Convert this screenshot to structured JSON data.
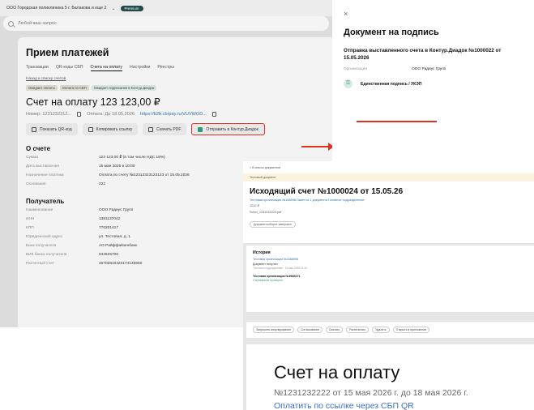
{
  "app": {
    "org": "ООО Городская поликлиника 5 г. Балакова и еще 2",
    "premium": "Premium",
    "search_placeholder": "Любой ваш запрос"
  },
  "page": {
    "title": "Прием платежей",
    "tabs": [
      "Транзакции",
      "QR-коды СБП",
      "Счета на оплату",
      "Настройки",
      "Реестры"
    ],
    "back": "Назад к списку счетов",
    "badges": [
      "Ожидает оплаты",
      "Оплата по СБП",
      "Ожидает подписания в Контур.Диадок"
    ],
    "invoice_title": "Счет на оплату 123 123,00 ₽",
    "number": "Номер: 1231232312...",
    "due": "Оплата: До 18.05.2026",
    "link": "https://b2b.cbrpay.ru/VUVWGD...",
    "actions": [
      "Показать QR-код",
      "Копировать ссылку",
      "Скачать PDF",
      "Отправить в Контур.Диадок"
    ]
  },
  "about": {
    "title": "О счете",
    "rows": [
      {
        "k": "Сумма",
        "v": "123 123,00 ₽ (в том числе НДС 18%)"
      },
      {
        "k": "Дата выставления",
        "v": "15 мая 2026 в 10:00"
      },
      {
        "k": "Назначение платежа",
        "v": "Оплата по счету №12312323123123 от 15.05.2026"
      },
      {
        "k": "Основание",
        "v": "222"
      }
    ]
  },
  "receiver": {
    "title": "Получатель",
    "rows": [
      {
        "k": "Наименование",
        "v": "ООО Радиус Групп"
      },
      {
        "k": "ИНН",
        "v": "1381137042"
      },
      {
        "k": "КПП",
        "v": "770201417"
      },
      {
        "k": "Юридический адрес",
        "v": "ул. Тестовая, д. 1"
      },
      {
        "k": "Банк получателя",
        "v": "АО Райффайзенбанк"
      },
      {
        "k": "БИК банка получателя",
        "v": "044525700"
      },
      {
        "k": "Расчетный счет",
        "v": "40702810424174145650"
      }
    ]
  },
  "drawer": {
    "close": "×",
    "title": "Документ на подпись",
    "subtitle": "Отправка выставленного счета в Контур.Диадок №1000022 от 15.05.2026",
    "org_label": "Организация",
    "org_value": "ООО Радиус Групп",
    "signature": "Единственная подпись / УКЭП"
  },
  "doc": {
    "crumb": "< В список документов",
    "test": "Тестовый документ",
    "title": "Исходящий счет №1000024 от 15.05.26",
    "line1": "Тестовая организация №168598   Пакет из 1 документа   Головное подразделение",
    "amount": "1212 ₽",
    "file": "Schet_1231232222.pdf",
    "btn": "Документооборот завершен",
    "history_title": "История",
    "h1": "Тестовая организация №1686998",
    "h2": "Документ получен",
    "h3": "Тестовое подразделение · 15 мая 2026 10:34",
    "h4": "Тестовая организация №9683271",
    "h5": "Сертификат проверен",
    "toolbar": [
      "Запросить аннулирование",
      "Согласование",
      "Скачать",
      "Распечатать",
      "Удалить",
      "Открыть в приложении"
    ],
    "paper_title": "Счет на оплату",
    "paper_sub": "№1231232222 от 15 мая 2026 г. до 18 мая 2026 г.",
    "paper_link": "Оплатить по ссылке через СБП QR"
  }
}
